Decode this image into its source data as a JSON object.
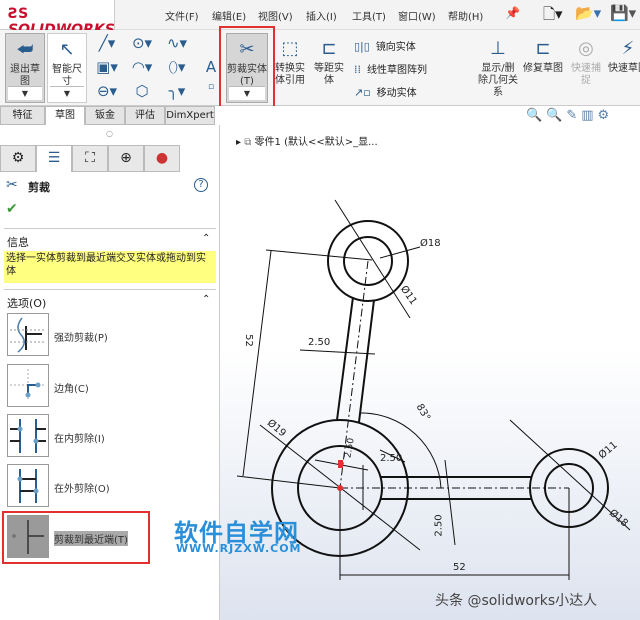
{
  "app": {
    "logo": "SOLIDWORKS"
  },
  "menu": [
    "文件(F)",
    "编辑(E)",
    "视图(V)",
    "插入(I)",
    "工具(T)",
    "窗口(W)",
    "帮助(H)"
  ],
  "ribbon": {
    "exit_sketch": "退出草图",
    "smart_dimension": "智能尺寸",
    "trim_entities": "剪裁实体(T)",
    "convert_entities": "转换实体引用",
    "offset_entities": "等距实体",
    "mirror": "镜向实体",
    "linear_pattern": "线性草图阵列",
    "move": "移动实体",
    "relations": "显示/删除几何关系",
    "repair": "修复草图",
    "quick_snaps": "快速捕捉",
    "rapid_sketch": "快速草图"
  },
  "tabs": [
    "特征",
    "草图",
    "钣金",
    "评估",
    "DimXpert"
  ],
  "tree": {
    "item": "零件1 (默认<<默认>_显..."
  },
  "panel": {
    "title": "剪裁",
    "help": "?",
    "info_header": "信息",
    "info_text": "选择一实体剪裁到最近端交叉实体或拖动到实体",
    "options_header": "选项(O)",
    "options": [
      "强劲剪裁(P)",
      "边角(C)",
      "在内剪除(I)",
      "在外剪除(O)",
      "剪裁到最近端(T)"
    ]
  },
  "drawing": {
    "dims": [
      "Ø18",
      "Ø11",
      "52",
      "2.50",
      "83°",
      "Ø19",
      "2.50",
      "2.50",
      "Ø11",
      "Ø18",
      "2.50",
      "52",
      "2.50"
    ]
  },
  "watermark": {
    "title": "软件自学网",
    "url": "WWW.RJZXW.COM"
  },
  "credit": "头条 @solidworks小达人",
  "colors": {
    "highlight": "#e03030",
    "info_bg": "#ffff80"
  }
}
